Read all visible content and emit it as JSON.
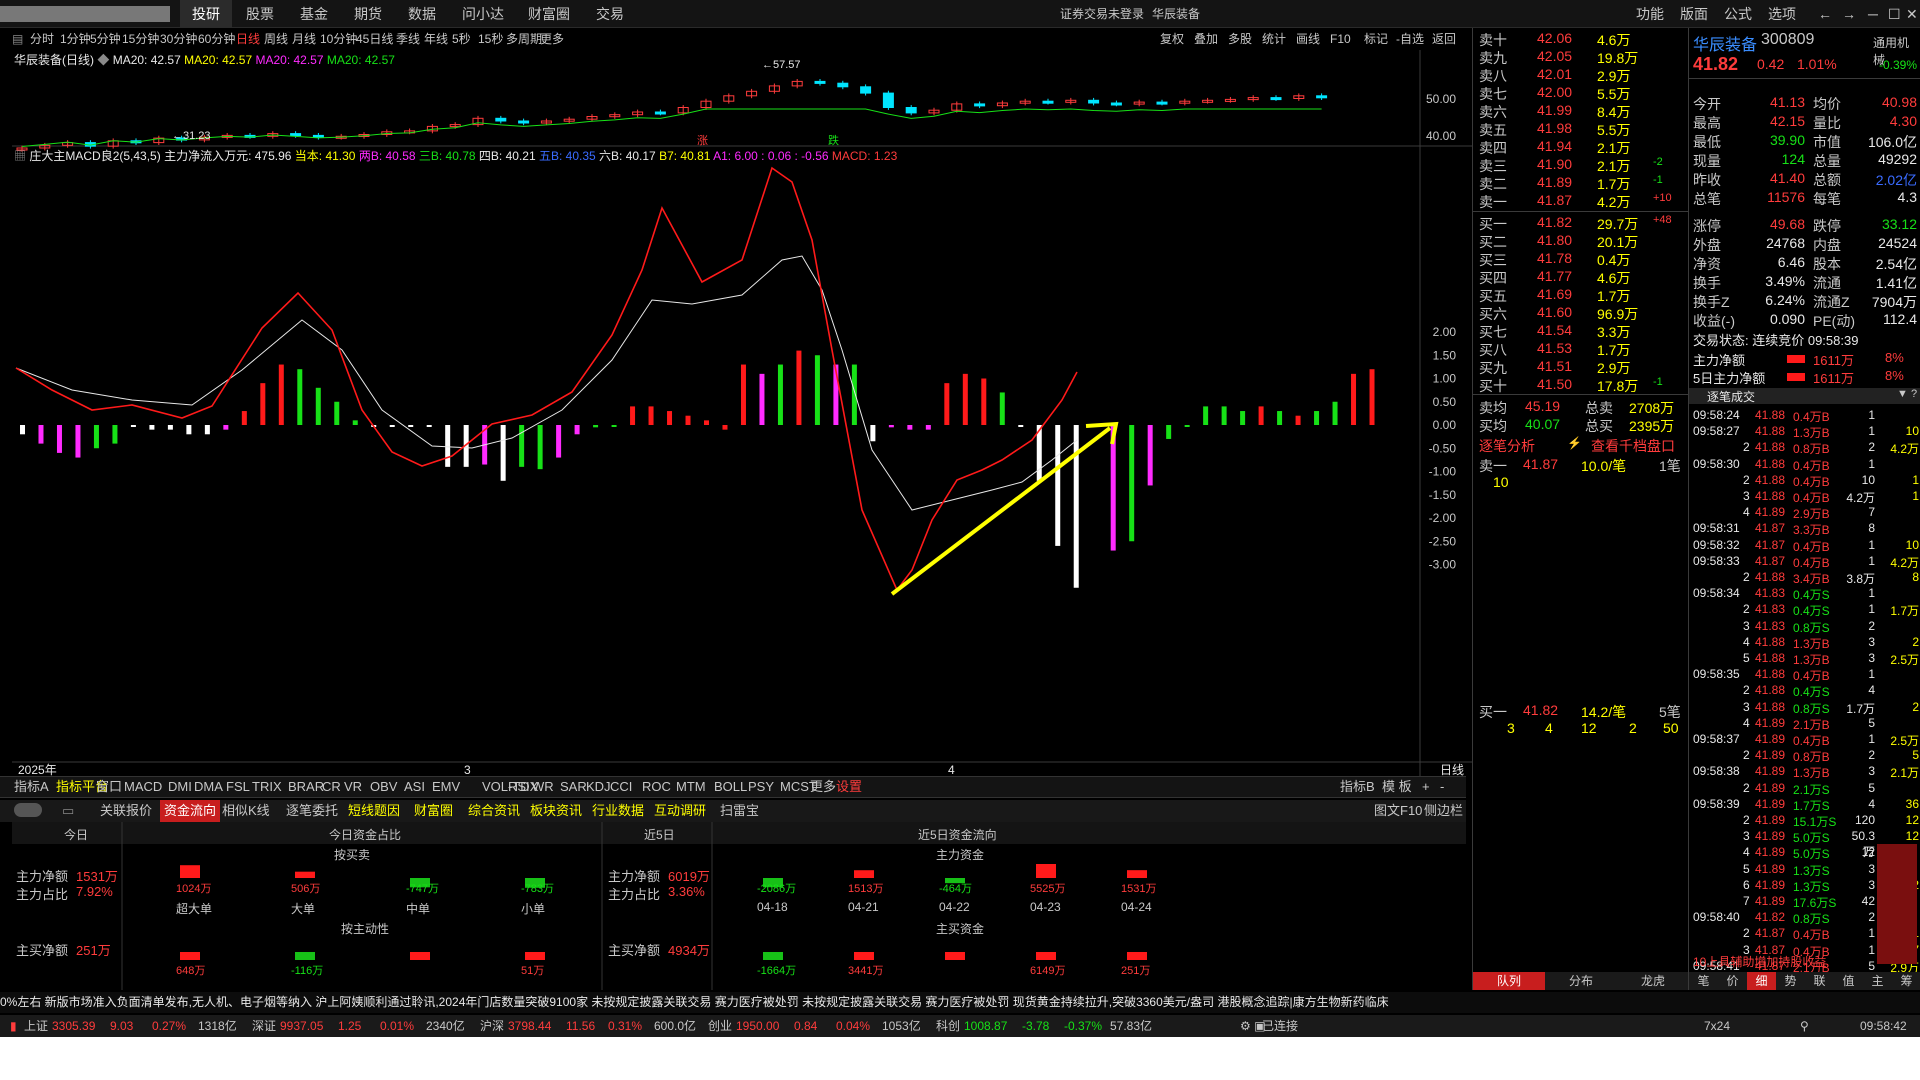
{
  "topbar": {
    "nav": [
      "投研",
      "股票",
      "基金",
      "期货",
      "数据",
      "问小达",
      "财富圈",
      "交易"
    ],
    "login": "证券交易未登录",
    "stockname": "华辰装备",
    "right": [
      "功能",
      "版面",
      "公式",
      "选项"
    ]
  },
  "periods": [
    "分时",
    "1分钟",
    "5分钟",
    "15分钟",
    "30分钟",
    "60分钟",
    "日线",
    "周线",
    "月线",
    "10分钟",
    "45日线",
    "季线",
    "年线",
    "5秒",
    "15秒",
    "多周期",
    "更多"
  ],
  "tools": [
    "复权",
    "叠加",
    "多股",
    "统计",
    "画线",
    "F10",
    "标记",
    "-自选",
    "返回"
  ],
  "chart": {
    "title": "华辰装备(日线)",
    "ma_text": "MA20: 42.57",
    "ma_text2": "MA20: 42.57",
    "ma_text3": "MA20: 42.57",
    "ma_text4": "MA20: 42.57",
    "high_label": "57.57",
    "low_label": "31.23",
    "up_mark": "涨",
    "down_mark": "跌",
    "price_ticks": [
      "50.00",
      "40.00"
    ],
    "ind_title": "庄大主MACD良2(5,43,5)",
    "ind_items": [
      [
        "主力净流入万元: 475.96",
        "#e8e8e8"
      ],
      [
        "当本: 41.30",
        "#ffff00"
      ],
      [
        "两B: 40.58",
        "#ff2bff"
      ],
      [
        "三B: 40.78",
        "#17e117"
      ],
      [
        "四B: 40.21",
        "#e8e8e8"
      ],
      [
        "五B: 40.35",
        "#3a6bff"
      ],
      [
        "六B: 40.17",
        "#e8e8e8"
      ],
      [
        "B7: 40.81",
        "#ffff00"
      ],
      [
        "A1: 6.00 : 0.06 : -0.56",
        "#ff2bff"
      ],
      [
        "MACD: 1.23",
        "#ff3c3c"
      ]
    ],
    "macd_ticks": [
      "2.00",
      "1.50",
      "1.00",
      "0.50",
      "0.00",
      "-0.50",
      "-1.00",
      "-1.50",
      "-2.00",
      "-2.50",
      "-3.00"
    ],
    "date_labels": [
      "2025年",
      "3",
      "4"
    ],
    "date_right": "日线"
  },
  "indicators": [
    "指标A",
    "指标平台",
    "窗口",
    "MACD",
    "DMI",
    "DMA",
    "FSL",
    "TRIX",
    "BRAR",
    "CR",
    "VR",
    "OBV",
    "ASI",
    "EMV",
    "VOL-TDX",
    "RSI",
    "WR",
    "SAR",
    "KDJ",
    "CCI",
    "ROC",
    "MTM",
    "BOLL",
    "PSY",
    "MCST",
    "更多",
    "设置"
  ],
  "indicators_right": [
    "指标B",
    "模 板",
    "+",
    "-"
  ],
  "tabs2": [
    "关联报价",
    "资金流向",
    "相似K线",
    "逐笔委托",
    "短线题因",
    "财富圈",
    "综合资讯",
    "板块资讯",
    "行业数据",
    "互动调研",
    "扫雷宝"
  ],
  "tabs2_right": [
    "图文F10",
    "侧边栏"
  ],
  "fund": {
    "today": "今日",
    "today_ratio": "今日资金占比",
    "near5": "近5日",
    "near5_flow": "近5日资金流向",
    "buysell": "按买卖",
    "main_fund": "主力资金",
    "active": "按主动性",
    "main_buy_fund": "主买资金",
    "l1": "主力净额",
    "v1": "1531万",
    "l2": "主力占比",
    "v2": "7.92%",
    "l3": "主买净额",
    "v3": "251万",
    "r1": "主力净额",
    "rv1": "6019万",
    "r2": "主力占比",
    "rv2": "3.36%",
    "r3": "主买净额",
    "rv3": "4934万",
    "bars": [
      [
        "1024万",
        "超大单",
        1024
      ],
      [
        "506万",
        "大单",
        506
      ],
      [
        "-747万",
        "中单",
        -747
      ],
      [
        "-783万",
        "小单",
        -783
      ]
    ],
    "bars2": [
      [
        "648万",
        648
      ],
      [
        "-116万",
        -116
      ],
      [
        "",
        0
      ],
      [
        "51万",
        51
      ]
    ],
    "days": [
      [
        "-2086万",
        "04-18",
        -2086
      ],
      [
        "1513万",
        "04-21",
        1513
      ],
      [
        "-464万",
        "04-22",
        -464
      ],
      [
        "5525万",
        "04-23",
        5525
      ],
      [
        "1531万",
        "04-24",
        1531
      ]
    ],
    "days2": [
      [
        "-1664万",
        -1664
      ],
      [
        "3441万",
        3441
      ],
      [
        "",
        300
      ],
      [
        "6149万",
        6149
      ],
      [
        "251万",
        251
      ]
    ]
  },
  "quote": {
    "sells": [
      [
        "卖十",
        "42.06",
        "4.6万",
        ""
      ],
      [
        "卖九",
        "42.05",
        "19.8万",
        ""
      ],
      [
        "卖八",
        "42.01",
        "2.9万",
        ""
      ],
      [
        "卖七",
        "42.00",
        "5.5万",
        ""
      ],
      [
        "卖六",
        "41.99",
        "8.4万",
        ""
      ],
      [
        "卖五",
        "41.98",
        "5.5万",
        ""
      ],
      [
        "卖四",
        "41.94",
        "2.1万",
        ""
      ],
      [
        "卖三",
        "41.90",
        "2.1万",
        "-2"
      ],
      [
        "卖二",
        "41.89",
        "1.7万",
        "-1"
      ],
      [
        "卖一",
        "41.87",
        "4.2万",
        "+10"
      ]
    ],
    "buys": [
      [
        "买一",
        "41.82",
        "29.7万",
        "+48"
      ],
      [
        "买二",
        "41.80",
        "20.1万",
        ""
      ],
      [
        "买三",
        "41.78",
        "0.4万",
        ""
      ],
      [
        "买四",
        "41.77",
        "4.6万",
        ""
      ],
      [
        "买五",
        "41.69",
        "1.7万",
        ""
      ],
      [
        "买六",
        "41.60",
        "96.9万",
        ""
      ],
      [
        "买七",
        "41.54",
        "3.3万",
        ""
      ],
      [
        "买八",
        "41.53",
        "1.7万",
        ""
      ],
      [
        "买九",
        "41.51",
        "2.9万",
        ""
      ],
      [
        "买十",
        "41.50",
        "17.8万",
        "-1"
      ]
    ],
    "avg_sell": [
      "卖均",
      "45.19",
      "总卖",
      "2708万"
    ],
    "avg_buy": [
      "买均",
      "40.07",
      "总买",
      "2395万"
    ],
    "zhubi_title": "逐笔分析",
    "zhubi_link": "查看千档盘口",
    "ask1": [
      "卖一",
      "41.87",
      "10.0/笔",
      "1笔"
    ],
    "ask1_q": "10",
    "bid1": [
      "买一",
      "41.82",
      "14.2/笔",
      "5笔"
    ],
    "bid1_q": [
      "3",
      "4",
      "12",
      "2",
      "50"
    ],
    "tabs": [
      "队列",
      "分布",
      "龙虎"
    ]
  },
  "detail": {
    "name": "华辰装备",
    "code": "300809",
    "industry": "通用机械",
    "price": "41.82",
    "chg": "0.42",
    "pct": "1.01%",
    "side_pct": "-0.39%",
    "grid": [
      [
        "今开",
        "41.13",
        "均价",
        "40.98"
      ],
      [
        "最高",
        "42.15",
        "量比",
        "4.30"
      ],
      [
        "最低",
        "39.90",
        "市值",
        "106.0亿"
      ],
      [
        "现量",
        "124",
        "总量",
        "49292"
      ],
      [
        "昨收",
        "41.40",
        "总额",
        "2.02亿"
      ],
      [
        "总笔",
        "11576",
        "每笔",
        "4.3"
      ],
      [
        "涨停",
        "49.68",
        "跌停",
        "33.12"
      ],
      [
        "外盘",
        "24768",
        "内盘",
        "24524"
      ],
      [
        "净资",
        "6.46",
        "股本",
        "2.54亿"
      ],
      [
        "换手",
        "3.49%",
        "流通",
        "1.41亿"
      ],
      [
        "换手Z",
        "6.24%",
        "流通Z",
        "7904万"
      ],
      [
        "收益(-)",
        "0.090",
        "PE(动)",
        "112.4"
      ]
    ],
    "trade_status": "交易状态: 连续竞价 09:58:39",
    "flow": [
      [
        "主力净额",
        "1611万",
        "8%"
      ],
      [
        "5日主力净额",
        "1611万",
        "8%"
      ]
    ],
    "ticks_title": "逐笔成交",
    "ticks": [
      [
        "09:58:24",
        "41.88",
        "0.4万B",
        "1",
        ""
      ],
      [
        "09:58:27",
        "41.88",
        "1.3万B",
        "1",
        "10"
      ],
      [
        "2",
        "41.88",
        "0.8万B",
        "2",
        "4.2万"
      ],
      [
        "09:58:30",
        "41.88",
        "0.4万B",
        "1",
        ""
      ],
      [
        "2",
        "41.88",
        "0.4万B",
        "10",
        "1"
      ],
      [
        "3",
        "41.88",
        "0.4万B",
        "4.2万",
        "1"
      ],
      [
        "4",
        "41.89",
        "2.9万B",
        "7",
        ""
      ],
      [
        "09:58:31",
        "41.87",
        "3.3万B",
        "8",
        ""
      ],
      [
        "09:58:32",
        "41.87",
        "0.4万B",
        "1",
        "10"
      ],
      [
        "09:58:33",
        "41.87",
        "0.4万B",
        "1",
        "4.2万"
      ],
      [
        "2",
        "41.88",
        "3.4万B",
        "3.8万",
        "8"
      ],
      [
        "09:58:34",
        "41.83",
        "0.4万S",
        "1",
        ""
      ],
      [
        "2",
        "41.83",
        "0.4万S",
        "1",
        "1.7万"
      ],
      [
        "3",
        "41.83",
        "0.8万S",
        "2",
        ""
      ],
      [
        "4",
        "41.88",
        "1.3万B",
        "3",
        "2"
      ],
      [
        "5",
        "41.88",
        "1.3万B",
        "3",
        "2.5万"
      ],
      [
        "09:58:35",
        "41.88",
        "0.4万B",
        "1",
        ""
      ],
      [
        "2",
        "41.88",
        "0.4万S",
        "4",
        ""
      ],
      [
        "3",
        "41.88",
        "0.8万S",
        "1.7万",
        "2"
      ],
      [
        "4",
        "41.89",
        "2.1万B",
        "5",
        ""
      ],
      [
        "09:58:37",
        "41.89",
        "0.4万B",
        "1",
        "2.5万"
      ],
      [
        "2",
        "41.89",
        "0.8万B",
        "2",
        "5"
      ],
      [
        "09:58:38",
        "41.89",
        "1.3万B",
        "3",
        "2.1万"
      ],
      [
        "2",
        "41.89",
        "2.1万S",
        "5",
        ""
      ],
      [
        "09:58:39",
        "41.89",
        "1.7万S",
        "4",
        "36"
      ],
      [
        "2",
        "41.89",
        "15.1万S",
        "120",
        "12"
      ],
      [
        "3",
        "41.89",
        "5.0万S",
        "50.3万",
        "12"
      ],
      [
        "4",
        "41.89",
        "5.0万S",
        "12",
        ""
      ],
      [
        "5",
        "41.89",
        "1.3万S",
        "3",
        ""
      ],
      [
        "6",
        "41.89",
        "1.3万S",
        "3",
        "42"
      ],
      [
        "7",
        "41.89",
        "17.6万S",
        "42",
        ""
      ],
      [
        "09:58:40",
        "41.82",
        "0.8万S",
        "2",
        ""
      ],
      [
        "2",
        "41.87",
        "0.4万B",
        "1",
        "1"
      ],
      [
        "3",
        "41.87",
        "0.4万B",
        "1",
        "7"
      ],
      [
        "09:58:41",
        "41.87",
        "2.1万B",
        "5",
        "2.9万"
      ]
    ],
    "bottom_tabs": [
      "笔",
      "价",
      "细",
      "势",
      "联",
      "值",
      "主",
      "筹"
    ],
    "ticker_note": "10上具辅助增加持股收益"
  },
  "news": "0%左右      新版市场准入负面清单发布,无人机、电子烟等纳入      沪上阿姨顺利通过聆讯,2024年门店数量突破9100家      未按规定披露关联交易  赛力医疗被处罚      未按规定披露关联交易  赛力医疗被处罚      现货黄金持续拉升,突破3360美元/盎司      港股概念追踪|康方生物新药临床",
  "status": {
    "sh": "上证",
    "sh_v": "3305.39",
    "sh_c": "9.03",
    "sh_p": "0.27%",
    "sh_a": "1318亿",
    "sz": "深证",
    "sz_v": "9937.05",
    "sz_c": "1.25",
    "sz_p": "0.01%",
    "sz_a": "2340亿",
    "hs": "沪深",
    "hs_v": "3798.44",
    "hs_c": "11.56",
    "hs_p": "0.31%",
    "hs_a": "600.0亿",
    "cy": "创业",
    "cy_v": "1950.00",
    "cy_c": "0.84",
    "cy_p": "0.04%",
    "cy_a": "1053亿",
    "kc": "科创",
    "kc_v": "1008.87",
    "kc_c": "-3.78",
    "kc_p": "-0.37%",
    "kc_a": "57.83亿",
    "conn": "已连接",
    "mode": "7x24",
    "time": "09:58:42"
  }
}
